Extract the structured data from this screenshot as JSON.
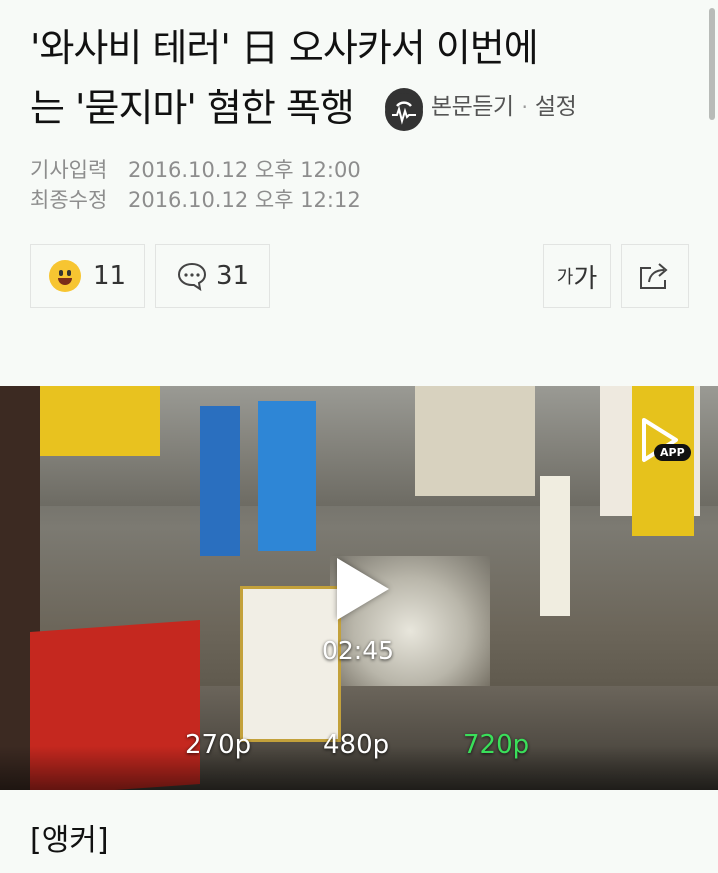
{
  "article": {
    "title_line1": "'와사비 테러' 日 오사카서 이번에",
    "title_line2": "는 '묻지마' 혐한 폭행",
    "listen_label": "본문듣기",
    "separator": "·",
    "settings_label": "설정"
  },
  "meta": {
    "input_label": "기사입력",
    "input_time": "2016.10.12 오후 12:00",
    "modified_label": "최종수정",
    "modified_time": "2016.10.12 오후 12:12"
  },
  "actions": {
    "like_count": "11",
    "comment_count": "31",
    "font_small": "가",
    "font_big": "가"
  },
  "video": {
    "duration": "02:45",
    "qualities": [
      "270p",
      "480p",
      "720p"
    ],
    "selected_quality": "720p",
    "app_badge": "APP",
    "selected_color": "#3adf5a"
  },
  "body": {
    "first_line": "[앵커]"
  },
  "icons": {
    "listen": "headphone-wave-icon",
    "like": "smile-emoji-icon",
    "comment": "speech-bubble-icon",
    "share": "share-icon",
    "play": "play-icon",
    "app": "app-play-icon"
  }
}
